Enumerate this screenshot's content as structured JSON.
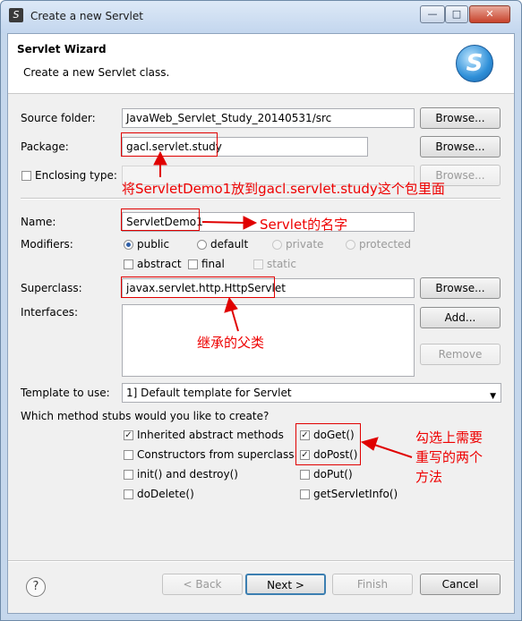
{
  "window": {
    "title": "Create a new Servlet"
  },
  "banner": {
    "title": "Servlet Wizard",
    "message": "Create a new Servlet class.",
    "logo_letter": "S"
  },
  "form": {
    "source_folder_label": "Source folder:",
    "source_folder_value": "JavaWeb_Servlet_Study_20140531/src",
    "package_label": "Package:",
    "package_value": "gacl.servlet.study",
    "enclosing_type_label": "Enclosing type:",
    "enclosing_type_checked": false,
    "browse_label": "Browse...",
    "name_label": "Name:",
    "name_value": "ServletDemo1",
    "modifiers_label": "Modifiers:",
    "modifiers": {
      "public": "public",
      "default": "default",
      "private": "private",
      "protected": "protected",
      "abstract": "abstract",
      "final": "final",
      "static": "static",
      "selected": "public"
    },
    "superclass_label": "Superclass:",
    "superclass_value": "javax.servlet.http.HttpServlet",
    "interfaces_label": "Interfaces:",
    "add_label": "Add...",
    "remove_label": "Remove",
    "template_label": "Template to use:",
    "template_value": "1] Default template for Servlet",
    "stubs_question": "Which method stubs would you like to create?"
  },
  "stubs": {
    "inherited_abstract": {
      "label": "Inherited abstract methods",
      "checked": true
    },
    "constructors": {
      "label": "Constructors from superclass",
      "checked": false
    },
    "init_destroy": {
      "label": "init() and destroy()",
      "checked": false
    },
    "do_delete": {
      "label": "doDelete()",
      "checked": false
    },
    "do_get": {
      "label": "doGet()",
      "checked": true
    },
    "do_post": {
      "label": "doPost()",
      "checked": true
    },
    "do_put": {
      "label": "doPut()",
      "checked": false
    },
    "get_servlet_info": {
      "label": "getServletInfo()",
      "checked": false
    }
  },
  "footer": {
    "help": "?",
    "back": "< Back",
    "next": "Next >",
    "finish": "Finish",
    "cancel": "Cancel"
  },
  "annotations": {
    "package_note": "将ServletDemo1放到gacl.servlet.study这个包里面",
    "name_note": "Servlet的名字",
    "superclass_note": "继承的父类",
    "methods_note_line1": "勾选上需要",
    "methods_note_line2": "重写的两个",
    "methods_note_line3": "方法"
  },
  "colors": {
    "annotation": "#e00000",
    "title_bar": "#c3d6ee",
    "dialog_bg": "#f0f0f0"
  }
}
